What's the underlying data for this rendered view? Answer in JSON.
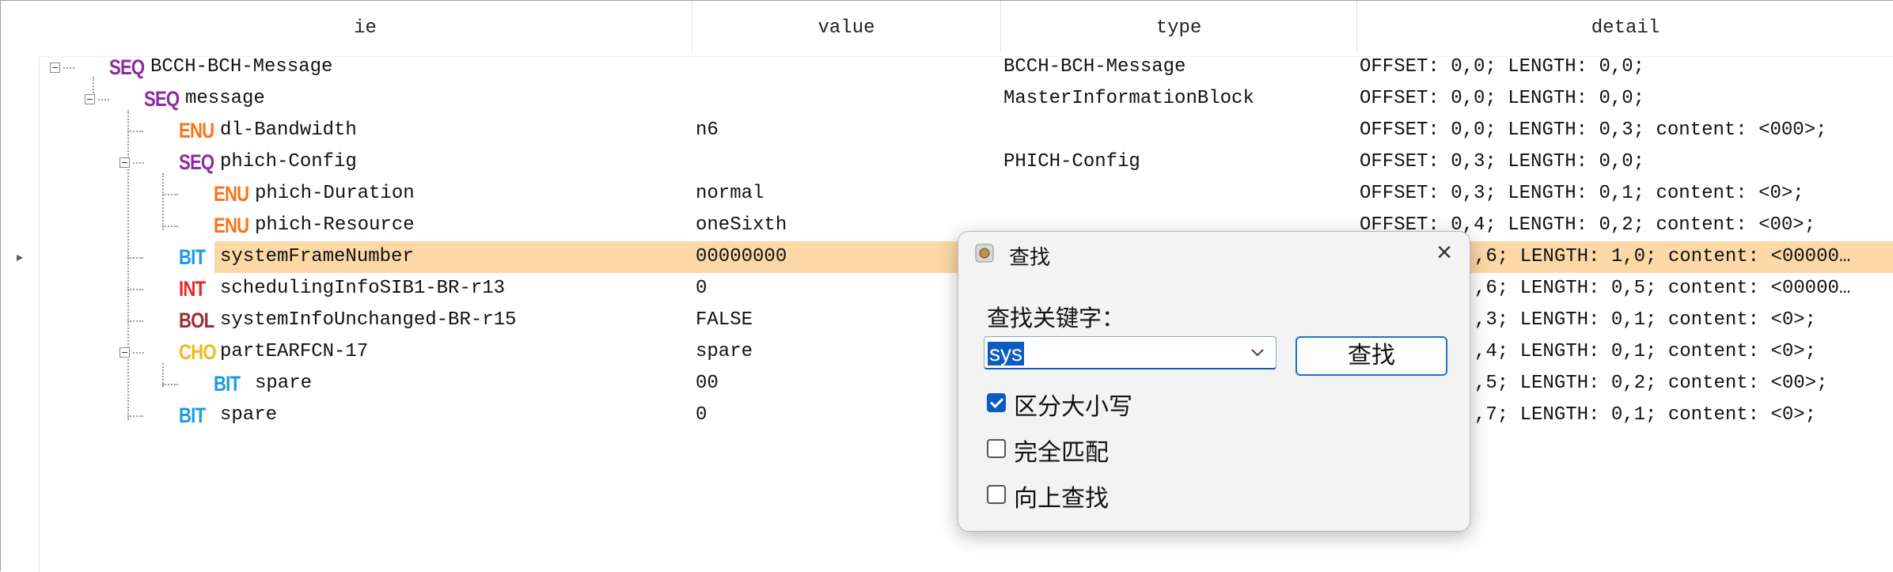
{
  "columns": {
    "ie": "ie",
    "value": "value",
    "type": "type",
    "detail": "detail"
  },
  "rows": [
    {
      "tag": "SEQ",
      "name": "BCCH-BCH-Message",
      "value": "",
      "type": "BCCH-BCH-Message",
      "detail": "OFFSET: 0,0; LENGTH: 0,0;"
    },
    {
      "tag": "SEQ",
      "name": "message",
      "value": "",
      "type": "MasterInformationBlock",
      "detail": "OFFSET: 0,0; LENGTH: 0,0;"
    },
    {
      "tag": "ENU",
      "name": "dl-Bandwidth",
      "value": "n6",
      "type": "",
      "detail": "OFFSET: 0,0; LENGTH: 0,3; content: <000>;"
    },
    {
      "tag": "SEQ",
      "name": "phich-Config",
      "value": "",
      "type": "PHICH-Config",
      "detail": "OFFSET: 0,3; LENGTH: 0,0;"
    },
    {
      "tag": "ENU",
      "name": "phich-Duration",
      "value": "normal",
      "type": "",
      "detail": "OFFSET: 0,3; LENGTH: 0,1; content: <0>;"
    },
    {
      "tag": "ENU",
      "name": "phich-Resource",
      "value": "oneSixth",
      "type": "",
      "detail": "OFFSET: 0,4; LENGTH: 0,2; content: <00>;"
    },
    {
      "tag": "BIT",
      "name": "systemFrameNumber",
      "value": "00000000",
      "type": "",
      "detail": ",6; LENGTH: 1,0; content: <00000…"
    },
    {
      "tag": "INT",
      "name": "schedulingInfoSIB1-BR-r13",
      "value": "0",
      "type": "",
      "detail": ",6; LENGTH: 0,5; content: <00000…"
    },
    {
      "tag": "BOL",
      "name": "systemInfoUnchanged-BR-r15",
      "value": "FALSE",
      "type": "",
      "detail": ",3; LENGTH: 0,1; content: <0>;"
    },
    {
      "tag": "CHO",
      "name": "partEARFCN-17",
      "value": "spare",
      "type": "",
      "detail": ",4; LENGTH: 0,1; content: <0>;"
    },
    {
      "tag": "BIT",
      "name": "spare",
      "value": "00",
      "type": "",
      "detail": ",5; LENGTH: 0,2; content: <00>;"
    },
    {
      "tag": "BIT",
      "name": "spare",
      "value": "0",
      "type": "",
      "detail": ",7; LENGTH: 0,1; content: <0>;"
    }
  ],
  "dialog": {
    "title": "查找",
    "keyword_label": "查找关键字：",
    "search_value": "sys",
    "find_button": "查找",
    "options": [
      {
        "label": "区分大小写",
        "checked": true
      },
      {
        "label": "完全匹配",
        "checked": false
      },
      {
        "label": "向上查找",
        "checked": false
      }
    ]
  },
  "colors": {
    "selected_row": "#fcd8a6",
    "SEQ": "#8e2aa4",
    "ENU": "#f57518",
    "BIT": "#1a98e8",
    "INT": "#ee2222",
    "BOL": "#a5282a",
    "CHO": "#f1b820",
    "accent": "#0b5cc2"
  }
}
